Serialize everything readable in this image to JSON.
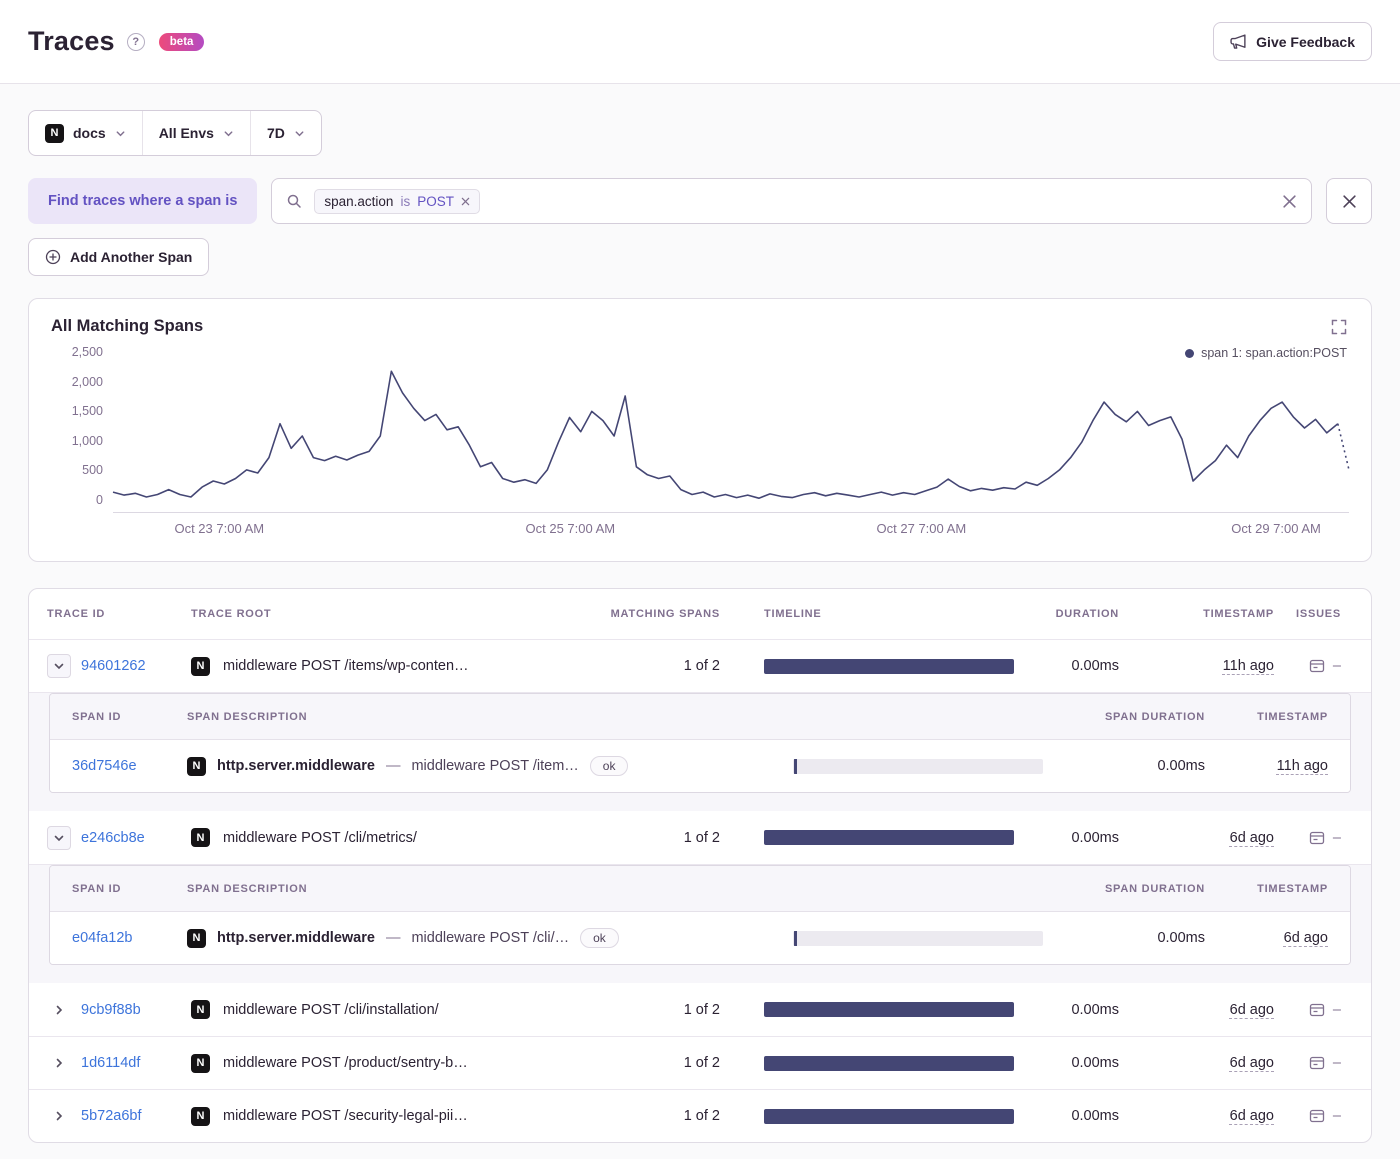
{
  "header": {
    "title": "Traces",
    "help": "?",
    "beta": "beta",
    "feedback": "Give Feedback"
  },
  "filters": {
    "project": "docs",
    "env": "All Envs",
    "range": "7D"
  },
  "search": {
    "find_label": "Find traces where a span is",
    "token_key": "span.action",
    "token_op": "is",
    "token_value": "POST",
    "add_span": "Add Another Span"
  },
  "ui": {
    "platform_letter": "N"
  },
  "chart": {
    "title": "All Matching Spans",
    "legend": "span 1: span.action:POST"
  },
  "chart_data": {
    "type": "line",
    "title": "All Matching Spans",
    "series_name": "span 1: span.action:POST",
    "line_color": "#444674",
    "ylim": [
      0,
      2500
    ],
    "y_ticks": [
      "2,500",
      "2,000",
      "1,500",
      "1,000",
      "500",
      "0"
    ],
    "x_ticks": [
      "Oct 23 7:00 AM",
      "Oct 25 7:00 AM",
      "Oct 27 7:00 AM",
      "Oct 29 7:00 AM"
    ],
    "x_tick_pos": [
      8.6,
      37.0,
      65.4,
      94.1
    ],
    "values": [
      340,
      290,
      320,
      260,
      300,
      380,
      300,
      260,
      420,
      520,
      470,
      560,
      700,
      650,
      900,
      1450,
      1050,
      1250,
      900,
      850,
      920,
      860,
      940,
      1000,
      1250,
      2300,
      1950,
      1700,
      1500,
      1600,
      1350,
      1400,
      1100,
      750,
      820,
      560,
      500,
      540,
      480,
      700,
      1150,
      1550,
      1320,
      1650,
      1500,
      1250,
      1900,
      750,
      620,
      560,
      600,
      380,
      300,
      340,
      260,
      300,
      250,
      290,
      240,
      310,
      270,
      250,
      300,
      330,
      280,
      320,
      290,
      260,
      300,
      340,
      290,
      330,
      300,
      360,
      420,
      550,
      430,
      360,
      400,
      370,
      410,
      390,
      500,
      450,
      560,
      700,
      900,
      1150,
      1500,
      1800,
      1600,
      1480,
      1650,
      1420,
      1500,
      1560,
      1200,
      520,
      700,
      850,
      1100,
      900,
      1250,
      1500,
      1700,
      1800,
      1560,
      1380,
      1520,
      1300,
      1450,
      700
    ]
  },
  "table": {
    "headers": [
      "TRACE ID",
      "TRACE ROOT",
      "MATCHING SPANS",
      "TIMELINE",
      "DURATION",
      "TIMESTAMP",
      "ISSUES"
    ],
    "sub_headers": [
      "SPAN ID",
      "SPAN DESCRIPTION",
      "SPAN DURATION",
      "TIMESTAMP"
    ],
    "rows": [
      {
        "trace_id": "94601262",
        "root": "middleware POST /items/wp-conten…",
        "matching": "1 of 2",
        "duration": "0.00ms",
        "timestamp": "11h ago",
        "issues": "–",
        "spans": [
          {
            "span_id": "36d7546e",
            "op": "http.server.middleware",
            "sep": "—",
            "description": "middleware POST /item…",
            "status": "ok",
            "duration": "0.00ms",
            "timestamp": "11h ago"
          }
        ]
      },
      {
        "trace_id": "e246cb8e",
        "root": "middleware POST /cli/metrics/",
        "matching": "1 of 2",
        "duration": "0.00ms",
        "timestamp": "6d ago",
        "issues": "–",
        "spans": [
          {
            "span_id": "e04fa12b",
            "op": "http.server.middleware",
            "sep": "—",
            "description": "middleware POST /cli/…",
            "status": "ok",
            "duration": "0.00ms",
            "timestamp": "6d ago"
          }
        ]
      },
      {
        "trace_id": "9cb9f88b",
        "root": "middleware POST /cli/installation/",
        "matching": "1 of 2",
        "duration": "0.00ms",
        "timestamp": "6d ago",
        "issues": "–"
      },
      {
        "trace_id": "1d6114df",
        "root": "middleware POST /product/sentry-b…",
        "matching": "1 of 2",
        "duration": "0.00ms",
        "timestamp": "6d ago",
        "issues": "–"
      },
      {
        "trace_id": "5b72a6bf",
        "root": "middleware POST /security-legal-pii…",
        "matching": "1 of 2",
        "duration": "0.00ms",
        "timestamp": "6d ago",
        "issues": "–"
      }
    ]
  }
}
